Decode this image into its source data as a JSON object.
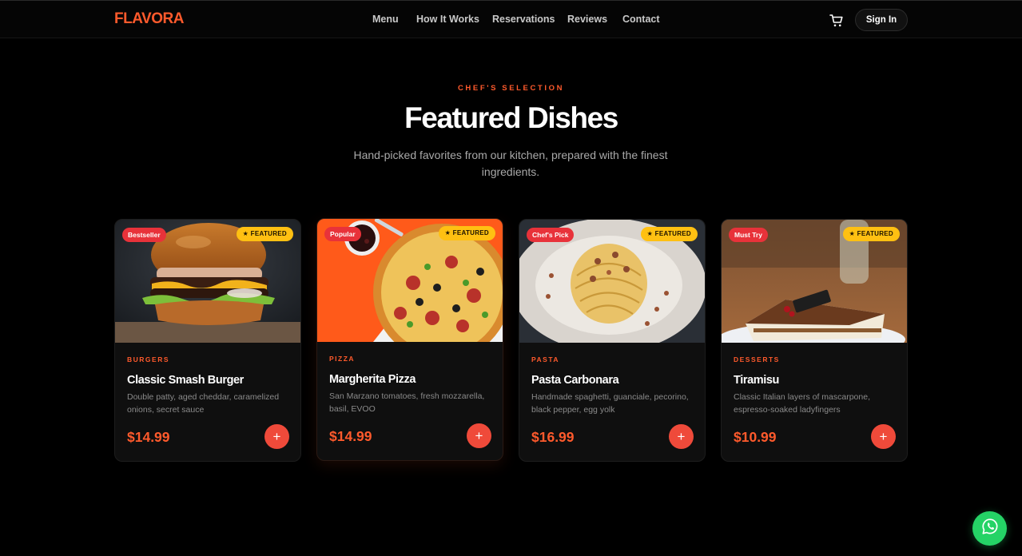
{
  "brand": {
    "logo": "FLAVORA",
    "accent": "#ff5a2c"
  },
  "nav": {
    "items": [
      "Menu",
      "How It Works",
      "Reservations",
      "Reviews",
      "Contact"
    ],
    "cart_icon": "cart-icon",
    "signin_label": "Sign In"
  },
  "section": {
    "eyebrow": "CHEF'S SELECTION",
    "title": "Featured Dishes",
    "subtitle": "Hand-picked favorites from our kitchen, prepared with the finest ingredients."
  },
  "featured_label": "★ FEATURED",
  "dishes": [
    {
      "tag": "Bestseller",
      "category": "BURGERS",
      "name": "Classic Smash Burger",
      "description": "Double patty, aged cheddar, caramelized onions, secret sauce",
      "price": "$14.99",
      "add_label": "+"
    },
    {
      "tag": "Popular",
      "category": "PIZZA",
      "name": "Margherita Pizza",
      "description": "San Marzano tomatoes, fresh mozzarella, basil, EVOO",
      "price": "$14.99",
      "add_label": "+"
    },
    {
      "tag": "Chef's Pick",
      "category": "PASTA",
      "name": "Pasta Carbonara",
      "description": "Handmade spaghetti, guanciale, pecorino, black pepper, egg yolk",
      "price": "$16.99",
      "add_label": "+"
    },
    {
      "tag": "Must Try",
      "category": "DESSERTS",
      "name": "Tiramisu",
      "description": "Classic Italian layers of mascarpone, espresso-soaked ladyfingers",
      "price": "$10.99",
      "add_label": "+"
    }
  ],
  "floating": {
    "icon": "whatsapp-icon",
    "color": "#25d366"
  }
}
